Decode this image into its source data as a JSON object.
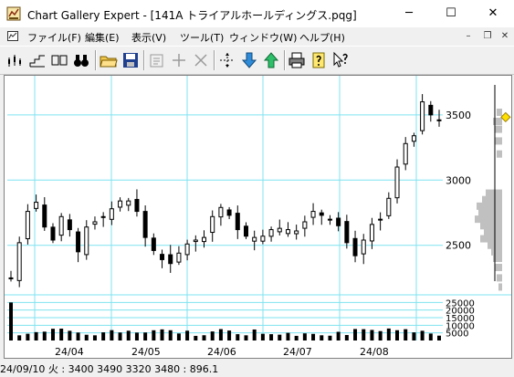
{
  "window": {
    "title": "Chart Gallery Expert - [141A トライアルホールディングス.pqg]",
    "minimize_glyph": "─",
    "maximize_glyph": "☐",
    "close_glyph": "✕"
  },
  "menu": {
    "items": [
      "ファイル(F)",
      "編集(E)",
      "表示(V)",
      "ツール(T)",
      "ウィンドウ(W)",
      "ヘルプ(H)"
    ],
    "mdi_minimize": "–",
    "mdi_restore": "❐",
    "mdi_close": "✕"
  },
  "toolbar": {
    "icons": [
      "candlestick-chart-icon",
      "line-chart-icon",
      "split-view-icon",
      "binoculars-icon",
      "open-folder-icon",
      "save-disk-icon",
      "properties-icon",
      "add-icon",
      "delete-icon",
      "move-icon",
      "arrow-down-icon",
      "arrow-up-icon",
      "print-icon",
      "help-icon",
      "context-help-icon"
    ]
  },
  "status": {
    "text": "24/09/10 火 : 3400 3490 3320 3480 : 896.1"
  },
  "colors": {
    "grid": "#7fe3f0",
    "candle": "#000000",
    "volume_profile": "#c0c0c0",
    "marker": "#ffe000"
  },
  "chart_data": {
    "type": "candlestick",
    "price_axis": {
      "ylim": [
        2120,
        3800
      ],
      "ticks": [
        2500,
        3000,
        3500
      ]
    },
    "volume_axis": {
      "ylim": [
        0,
        30000
      ],
      "ticks": [
        5000,
        10000,
        15000,
        20000,
        25000
      ],
      "tick_labels": [
        "5000",
        "10000",
        "15000",
        "20000",
        "25000"
      ]
    },
    "x_axis": {
      "labels": [
        "24/04",
        "24/05",
        "24/06",
        "24/07",
        "24/08"
      ]
    },
    "price_line": [
      2250,
      2520,
      2760,
      2830,
      2640,
      2540,
      2720,
      2620,
      2450,
      2640,
      2680,
      2720,
      2780,
      2840,
      2840,
      2760,
      2560,
      2460,
      2390,
      2360,
      2440,
      2510,
      2540,
      2560,
      2720,
      2790,
      2730,
      2620,
      2570,
      2560,
      2570,
      2620,
      2630,
      2620,
      2610,
      2680,
      2760,
      2730,
      2700,
      2650,
      2520,
      2420,
      2540,
      2660,
      2700,
      2860,
      3100,
      3280,
      3340,
      3600,
      3500,
      3460
    ],
    "volume_profile": [
      [
        3520,
        3
      ],
      [
        3450,
        5
      ],
      [
        3390,
        4
      ],
      [
        3300,
        4
      ],
      [
        3200,
        3
      ],
      [
        2900,
        9
      ],
      [
        2850,
        11
      ],
      [
        2800,
        14
      ],
      [
        2750,
        13
      ],
      [
        2700,
        15
      ],
      [
        2650,
        12
      ],
      [
        2600,
        10
      ],
      [
        2550,
        12
      ],
      [
        2500,
        8
      ],
      [
        2450,
        6
      ],
      [
        2400,
        5
      ],
      [
        2330,
        4
      ],
      [
        2250,
        3
      ],
      [
        2180,
        2
      ]
    ],
    "last_price": 3480
  }
}
